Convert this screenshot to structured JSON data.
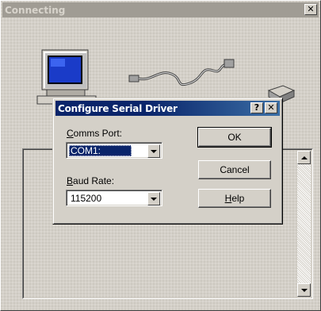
{
  "outer_window": {
    "title": "Connecting",
    "close_glyph": "✕",
    "icons": [
      "computer-icon",
      "serial-cable-icon",
      "modem-icon"
    ]
  },
  "dialog": {
    "title": "Configure Serial Driver",
    "help_glyph": "?",
    "close_glyph": "✕",
    "comms_port": {
      "label_accel": "C",
      "label_rest": "omms Port:",
      "value": "COM1:"
    },
    "baud_rate": {
      "label_accel": "B",
      "label_rest": "aud Rate:",
      "value": "115200"
    },
    "buttons": {
      "ok": "OK",
      "cancel": "Cancel",
      "help_accel": "H",
      "help_rest": "elp"
    }
  },
  "colors": {
    "titlebar_active": "#0a246a",
    "titlebar_inactive": "#a09c94",
    "face": "#d4d0c8",
    "selection": "#0a246a"
  }
}
